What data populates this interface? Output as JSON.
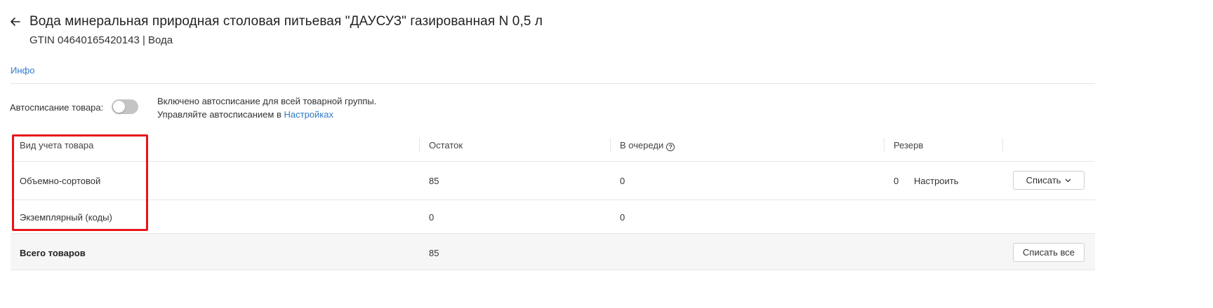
{
  "header": {
    "title": "Вода минеральная природная столовая питьевая \"ДАУСУЗ\" газированная N 0,5 л",
    "subtitle": "GTIN 04640165420143 | Вода"
  },
  "tabs": [
    {
      "label": "Инфо",
      "active": true
    }
  ],
  "autowriteoff": {
    "label": "Автосписание товара:",
    "enabled": false,
    "note_line1": "Включено автосписание для всей товарной группы.",
    "note_line2_prefix": "Управляйте автосписанием в",
    "note_link": "Настройках"
  },
  "table": {
    "columns": [
      "Вид учета товара",
      "Остаток",
      "В очереди",
      "Резерв"
    ],
    "rows": [
      {
        "type": "Объемно-сортовой",
        "balance": "85",
        "queue": "0",
        "reserve": "0",
        "configure": "Настроить",
        "action": "Списать"
      },
      {
        "type": "Экземплярный (коды)",
        "balance": "0",
        "queue": "0"
      }
    ],
    "total": {
      "label": "Всего товаров",
      "balance": "85",
      "action": "Списать все"
    }
  },
  "colors": {
    "accent": "#2f7ac8",
    "highlight": "#e8141a"
  }
}
